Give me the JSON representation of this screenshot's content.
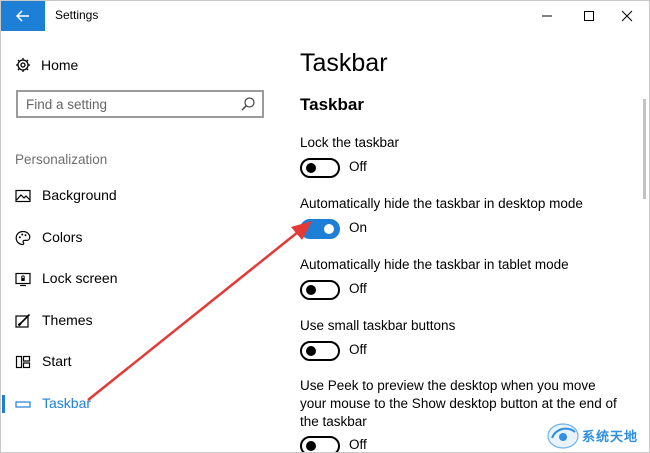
{
  "window": {
    "title": "Settings"
  },
  "sidebar": {
    "home_label": "Home",
    "search_placeholder": "Find a setting",
    "section_label": "Personalization",
    "items": [
      {
        "label": "Background",
        "icon": "picture-icon"
      },
      {
        "label": "Colors",
        "icon": "palette-icon"
      },
      {
        "label": "Lock screen",
        "icon": "lock-screen-icon"
      },
      {
        "label": "Themes",
        "icon": "themes-icon"
      },
      {
        "label": "Start",
        "icon": "start-icon"
      },
      {
        "label": "Taskbar",
        "icon": "taskbar-icon",
        "active": true
      }
    ]
  },
  "main": {
    "page_title": "Taskbar",
    "section_title": "Taskbar",
    "settings": [
      {
        "label": "Lock the taskbar",
        "state": "Off",
        "on": false
      },
      {
        "label": "Automatically hide the taskbar in desktop mode",
        "state": "On",
        "on": true
      },
      {
        "label": "Automatically hide the taskbar in tablet mode",
        "state": "Off",
        "on": false
      },
      {
        "label": "Use small taskbar buttons",
        "state": "Off",
        "on": false
      },
      {
        "label": "Use Peek to preview the desktop when you move your mouse to the Show desktop button at the end of the taskbar",
        "state": "Off",
        "on": false
      }
    ]
  },
  "colors": {
    "accent": "#1e7fd6",
    "annotation_arrow": "#e53935"
  },
  "watermark": {
    "text": "系统天地"
  }
}
